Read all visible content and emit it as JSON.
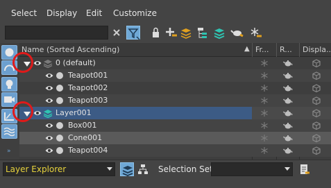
{
  "menu": {
    "select": "Select",
    "display": "Display",
    "edit": "Edit",
    "customize": "Customize"
  },
  "search": {
    "value": ""
  },
  "columns": {
    "name": "Name (Sorted Ascending)",
    "frozen": "Fr...",
    "render": "R...",
    "display": "Displa..."
  },
  "rows": [
    {
      "name": "0 (default)",
      "level": "layer",
      "highlight": false
    },
    {
      "name": "Teapot001",
      "level": "object",
      "highlight": false
    },
    {
      "name": "Teapot002",
      "level": "object",
      "highlight": false
    },
    {
      "name": "Teapot003",
      "level": "object",
      "highlight": false
    },
    {
      "name": "Layer001",
      "level": "layer",
      "highlight": true
    },
    {
      "name": "Box001",
      "level": "object",
      "highlight": false
    },
    {
      "name": "Cone001",
      "level": "object",
      "highlight": false
    },
    {
      "name": "Teapot004",
      "level": "object",
      "highlight": false
    }
  ],
  "bottom": {
    "explorer": "Layer Explorer",
    "selection_set_label": "Selection Set:",
    "selection_set_value": ""
  },
  "colors": {
    "accent": "#6fa8d6",
    "highlight_row": "#3c5b85",
    "annotation": "#e01a1a",
    "explorer_text": "#e6d23c"
  }
}
